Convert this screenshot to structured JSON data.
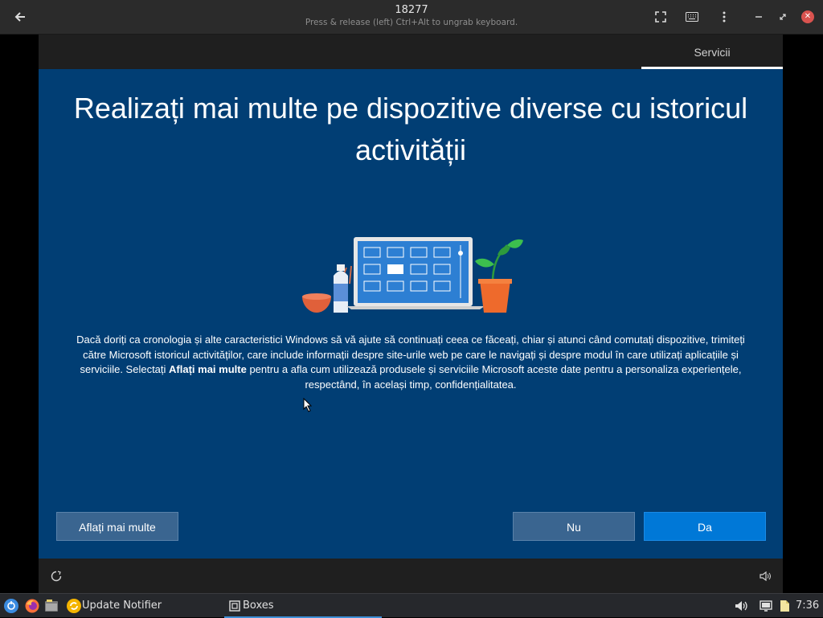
{
  "window": {
    "title": "18277",
    "subtitle": "Press & release (left) Ctrl+Alt to ungrab keyboard."
  },
  "icons": {
    "back": "arrow-left-icon",
    "fullscreen": "fullscreen-icon",
    "keyboard": "keyboard-icon",
    "menu": "kebab-menu-icon",
    "minimize": "minimize-icon",
    "restore": "restore-icon",
    "close": "close-icon"
  },
  "vm": {
    "tab_label": "Servicii",
    "heading": "Realizați mai multe pe dispozitive diverse cu istoricul activității",
    "body_part1": "Dacă doriți ca cronologia și alte caracteristici Windows să vă ajute să continuați ceea ce făceați, chiar și atunci când comutați dispozitive, trimiteți către Microsoft istoricul activităților, care include informații despre site-urile web pe care le navigați și despre modul în care utilizați aplicațiile și serviciile. Selectați ",
    "body_bold": "Aflați mai multe",
    "body_part2": " pentru a afla cum utilizează produsele și serviciile Microsoft aceste date pentru a personaliza experiențele, respectând, în același timp, confidențialitatea.",
    "buttons": {
      "learn_more": "Aflați mai multe",
      "no": "Nu",
      "yes": "Da"
    },
    "colors": {
      "background": "#013e74",
      "primary_button": "#0078d7",
      "secondary_button": "#3a6590"
    }
  },
  "taskbar": {
    "update_notifier": "Update Notifier",
    "boxes": "Boxes",
    "clock": "7:36"
  }
}
